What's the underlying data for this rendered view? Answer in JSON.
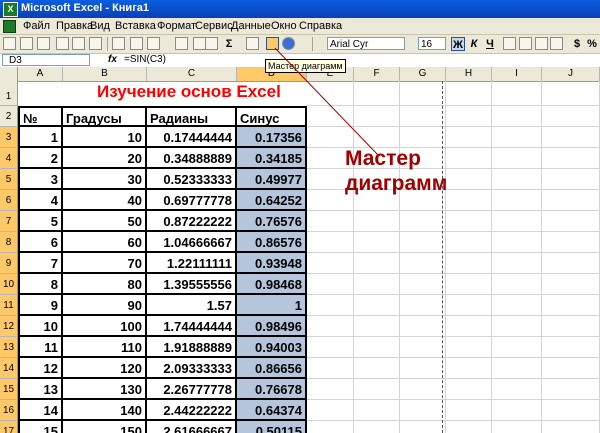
{
  "window": {
    "app_icon": "excel-icon",
    "title": "Microsoft Excel - Книга1"
  },
  "menu": [
    "Файл",
    "Правка",
    "Вид",
    "Вставка",
    "Формат",
    "Сервис",
    "Данные",
    "Окно",
    "Справка"
  ],
  "toolbar": {
    "font_name": "Arial Cyr",
    "font_size": "16",
    "bold": "Ж",
    "italic": "К",
    "underline": "Ч",
    "currency": "$",
    "percent": "%",
    "sum": "Σ",
    "tooltip": "Мастер диаграмм"
  },
  "formula_bar": {
    "name_box": "D3",
    "fx": "fx",
    "formula": "=SIN(C3)"
  },
  "columns": [
    "A",
    "B",
    "C",
    "D",
    "E",
    "F",
    "G",
    "H",
    "I",
    "J"
  ],
  "rows": [
    "1",
    "2",
    "3",
    "4",
    "5",
    "6",
    "7",
    "8",
    "9",
    "10",
    "11",
    "12",
    "13",
    "14",
    "15",
    "16",
    "17"
  ],
  "sheet": {
    "title": "Изучение основ Excel",
    "headers": [
      "№",
      "Градусы",
      "Радианы",
      "Синус"
    ],
    "data": [
      [
        "1",
        "10",
        "0.17444444",
        "0.17356"
      ],
      [
        "2",
        "20",
        "0.34888889",
        "0.34185"
      ],
      [
        "3",
        "30",
        "0.52333333",
        "0.49977"
      ],
      [
        "4",
        "40",
        "0.69777778",
        "0.64252"
      ],
      [
        "5",
        "50",
        "0.87222222",
        "0.76576"
      ],
      [
        "6",
        "60",
        "1.04666667",
        "0.86576"
      ],
      [
        "7",
        "70",
        "1.22111111",
        "0.93948"
      ],
      [
        "8",
        "80",
        "1.39555556",
        "0.98468"
      ],
      [
        "9",
        "90",
        "1.57",
        "1"
      ],
      [
        "10",
        "100",
        "1.74444444",
        "0.98496"
      ],
      [
        "11",
        "110",
        "1.91888889",
        "0.94003"
      ],
      [
        "12",
        "120",
        "2.09333333",
        "0.86656"
      ],
      [
        "13",
        "130",
        "2.26777778",
        "0.76678"
      ],
      [
        "14",
        "140",
        "2.44222222",
        "0.64374"
      ],
      [
        "15",
        "150",
        "2.61666667",
        "0.50115"
      ]
    ]
  },
  "callout": {
    "line1": "Мастер",
    "line2": "диаграмм"
  }
}
